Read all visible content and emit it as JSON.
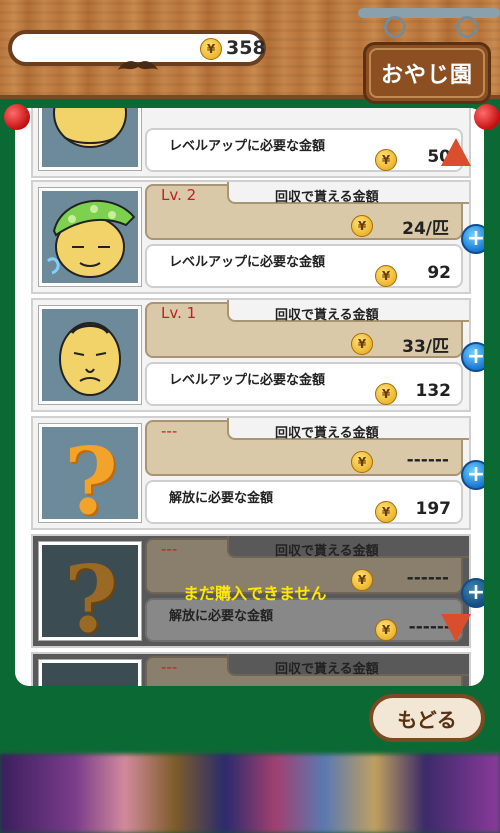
{
  "header": {
    "coins": "358",
    "coin_symbol": "¥",
    "sign_title": "おやじ園"
  },
  "list": {
    "earn_label": "回収で貰える金額",
    "rows": [
      {
        "type": "partial",
        "cost_label": "レベルアップに必要な金額",
        "cost": "50",
        "thumb": "bald-head-icon"
      },
      {
        "type": "owned",
        "level": "Lv. 2",
        "earn": "24/匹",
        "cost_label": "レベルアップに必要な金額",
        "cost": "92",
        "thumb": "sleepy-man-nightcap-icon"
      },
      {
        "type": "owned",
        "level": "Lv. 1",
        "earn": "33/匹",
        "cost_label": "レベルアップに必要な金額",
        "cost": "132",
        "thumb": "old-man-face-icon"
      },
      {
        "type": "unlockable",
        "level": "---",
        "earn": "------",
        "cost_label": "解放に必要な金額",
        "cost": "197",
        "thumb": "question-mark-icon"
      },
      {
        "type": "locked",
        "level": "---",
        "earn": "------",
        "cost_label": "解放に必要な金額",
        "cost": "------",
        "thumb": "question-mark-icon",
        "locked_text": "まだ購入できません"
      },
      {
        "type": "partial-bottom",
        "level": "---",
        "thumb": "question-mark-icon"
      }
    ]
  },
  "buttons": {
    "back": "もどる",
    "plus": "+"
  },
  "colors": {
    "frame_green": "#0b6a33",
    "wood": "#c98a4e",
    "level_red": "#c02020",
    "locked_yellow": "#ffe800"
  }
}
